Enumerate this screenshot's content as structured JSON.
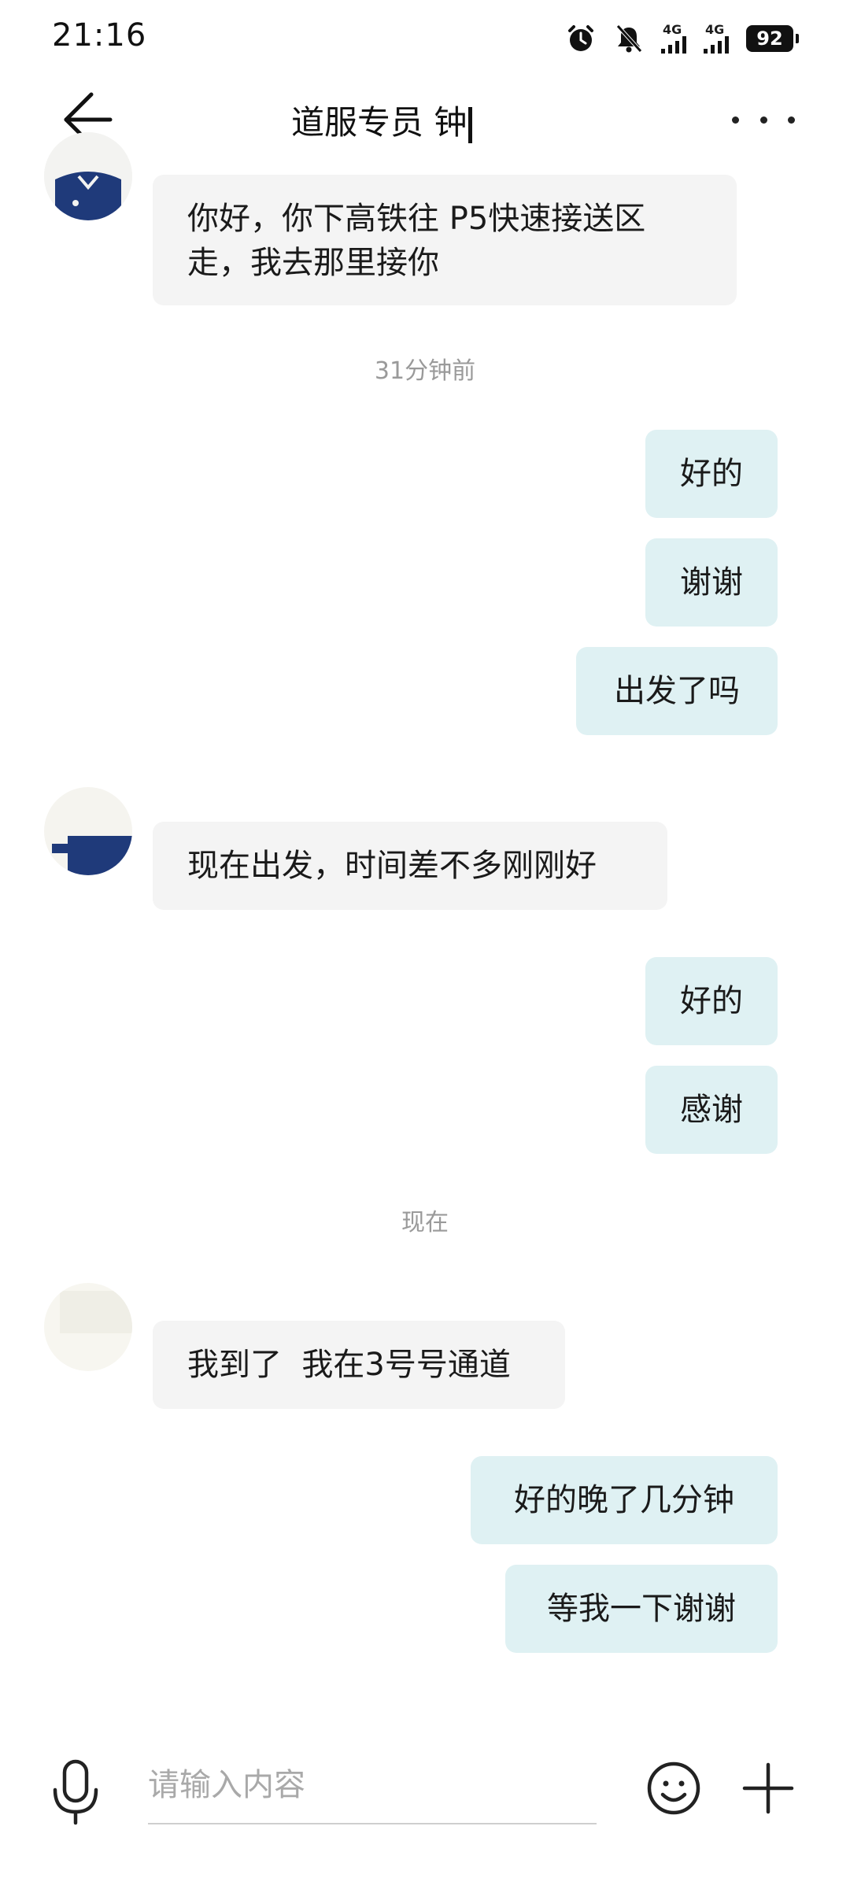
{
  "status_bar": {
    "time": "21:16",
    "network1": "4G",
    "network2": "4G",
    "battery": "92"
  },
  "header": {
    "title": "道服专员 钟"
  },
  "messages": [
    {
      "side": "in",
      "text": "你好，你下高铁往 P5快速接送区走，我去那里接你"
    },
    {
      "side": "time",
      "text": "31分钟前"
    },
    {
      "side": "out",
      "text": "好的"
    },
    {
      "side": "out",
      "text": "谢谢"
    },
    {
      "side": "out",
      "text": "出发了吗"
    },
    {
      "side": "in",
      "text": "现在出发，时间差不多刚刚好"
    },
    {
      "side": "out",
      "text": "好的"
    },
    {
      "side": "out",
      "text": "感谢"
    },
    {
      "side": "time",
      "text": "现在"
    },
    {
      "side": "in",
      "text": "我到了  我在3号号通道"
    },
    {
      "side": "out",
      "text": "好的晚了几分钟"
    },
    {
      "side": "out",
      "text": "等我一下谢谢"
    }
  ],
  "input": {
    "placeholder": "请输入内容"
  },
  "colors": {
    "incoming_bubble": "#f4f4f4",
    "outgoing_bubble": "#dff1f3",
    "timestamp": "#9a9a9a"
  },
  "icons": [
    "back-arrow-icon",
    "more-icon",
    "microphone-icon",
    "emoji-icon",
    "plus-icon",
    "alarm-icon",
    "mute-icon",
    "signal-icon",
    "battery-icon"
  ]
}
